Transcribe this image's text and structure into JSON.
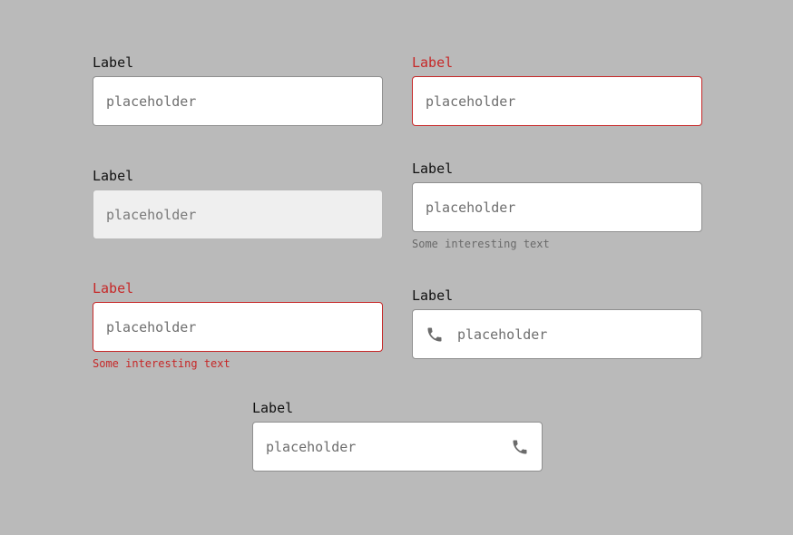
{
  "colors": {
    "background": "#bababa",
    "error": "#c62828",
    "border": "#8f8f8f",
    "disabled_fill": "#efefef"
  },
  "fields": [
    {
      "label": "Label",
      "placeholder": "placeholder",
      "state": "default"
    },
    {
      "label": "Label",
      "placeholder": "placeholder",
      "state": "error"
    },
    {
      "label": "Label",
      "placeholder": "placeholder",
      "state": "disabled"
    },
    {
      "label": "Label",
      "placeholder": "placeholder",
      "state": "default",
      "helper_text": "Some interesting text"
    },
    {
      "label": "Label",
      "placeholder": "placeholder",
      "state": "error",
      "helper_text": "Some interesting text"
    },
    {
      "label": "Label",
      "placeholder": "placeholder",
      "state": "default",
      "icon": "phone-icon",
      "icon_position": "leading"
    },
    {
      "label": "Label",
      "placeholder": "placeholder",
      "state": "default",
      "icon": "phone-icon",
      "icon_position": "trailing"
    }
  ]
}
